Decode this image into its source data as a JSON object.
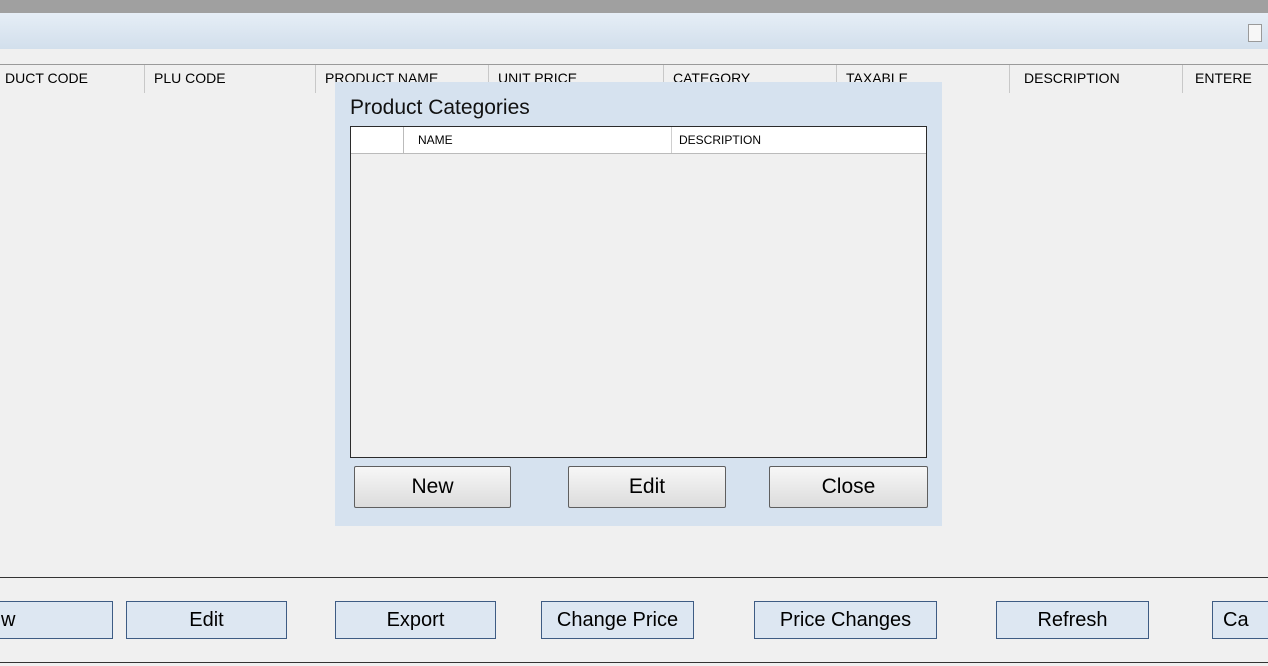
{
  "grid": {
    "columns": [
      "DUCT CODE",
      "PLU CODE",
      "PRODUCT NAME",
      "UNIT PRICE",
      "CATEGORY",
      "TAXABLE",
      "DESCRIPTION",
      "ENTERE"
    ]
  },
  "actions": {
    "new_label": "w",
    "edit_label": "Edit",
    "export_label": "Export",
    "change_price_label": "Change Price",
    "price_changes_label": "Price Changes",
    "refresh_label": "Refresh",
    "cancel_label": "Ca"
  },
  "dialog": {
    "title": "Product Categories",
    "columns": [
      "NAME",
      "DESCRIPTION"
    ],
    "rows": [],
    "new_label": "New",
    "edit_label": "Edit",
    "close_label": "Close"
  }
}
